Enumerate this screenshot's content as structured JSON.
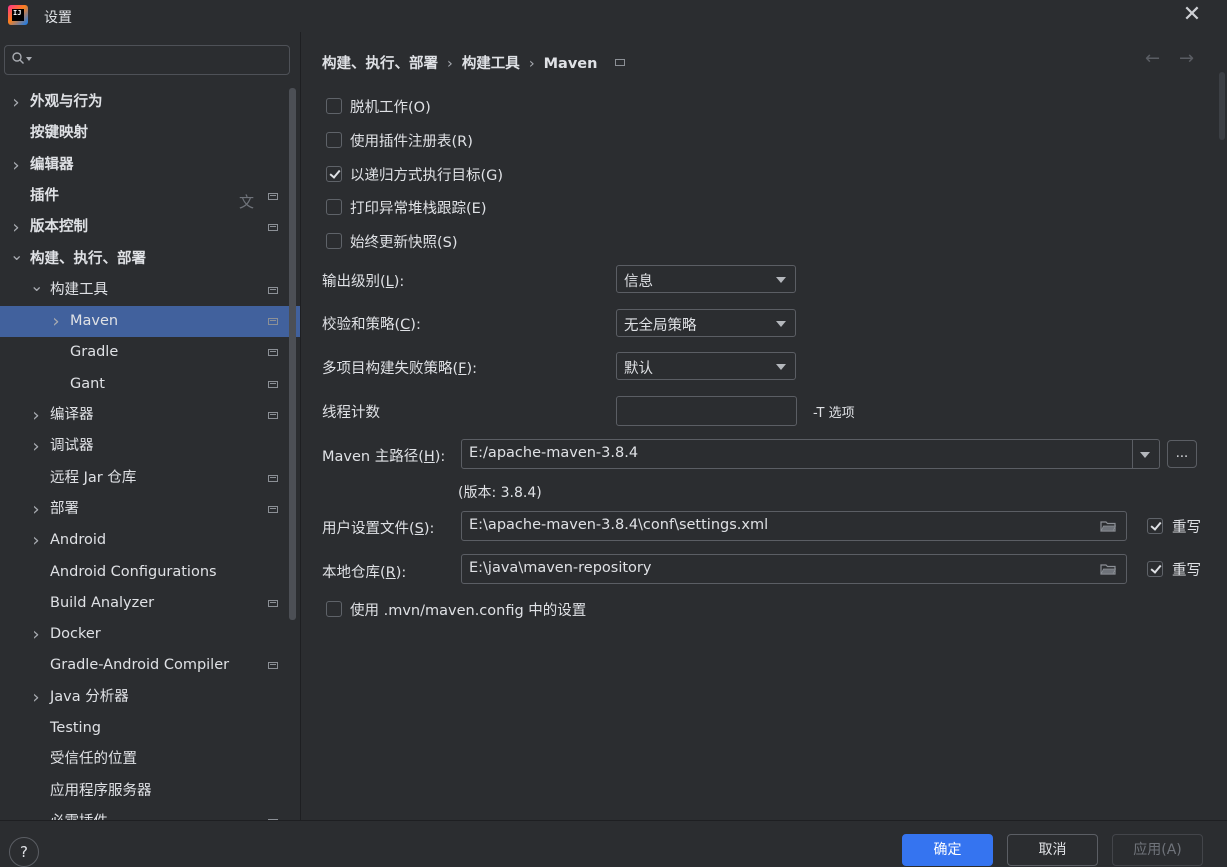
{
  "window": {
    "title": "设置"
  },
  "search": {
    "placeholder": ""
  },
  "sidebar": {
    "items": [
      {
        "label": "外观与行为",
        "bold": true,
        "chevron": "right"
      },
      {
        "label": "按键映射",
        "bold": true,
        "chevron": "none"
      },
      {
        "label": "编辑器",
        "bold": true,
        "chevron": "right"
      },
      {
        "label": "插件",
        "bold": true,
        "chevron": "none"
      },
      {
        "label": "版本控制",
        "bold": true,
        "chevron": "right"
      },
      {
        "label": "构建、执行、部署",
        "bold": true,
        "chevron": "down"
      },
      {
        "label": "构建工具",
        "bold": false,
        "chevron": "down"
      },
      {
        "label": "Maven",
        "bold": false,
        "chevron": "right",
        "selected": true
      },
      {
        "label": "Gradle",
        "bold": false,
        "chevron": "none"
      },
      {
        "label": "Gant",
        "bold": false,
        "chevron": "none"
      },
      {
        "label": "编译器",
        "bold": false,
        "chevron": "right"
      },
      {
        "label": "调试器",
        "bold": false,
        "chevron": "right"
      },
      {
        "label": "远程 Jar 仓库",
        "bold": false,
        "chevron": "none"
      },
      {
        "label": "部署",
        "bold": false,
        "chevron": "right"
      },
      {
        "label": "Android",
        "bold": false,
        "chevron": "right"
      },
      {
        "label": "Android Configurations",
        "bold": false,
        "chevron": "none"
      },
      {
        "label": "Build Analyzer",
        "bold": false,
        "chevron": "none"
      },
      {
        "label": "Docker",
        "bold": false,
        "chevron": "right"
      },
      {
        "label": "Gradle-Android Compiler",
        "bold": false,
        "chevron": "none"
      },
      {
        "label": "Java 分析器",
        "bold": false,
        "chevron": "right"
      },
      {
        "label": "Testing",
        "bold": false,
        "chevron": "none"
      },
      {
        "label": "受信任的位置",
        "bold": false,
        "chevron": "none"
      },
      {
        "label": "应用程序服务器",
        "bold": false,
        "chevron": "none"
      },
      {
        "label": "必需插件",
        "bold": false,
        "chevron": "none"
      }
    ]
  },
  "breadcrumb": {
    "items": [
      "构建、执行、部署",
      "构建工具",
      "Maven"
    ],
    "separator": "›"
  },
  "options": {
    "offline": {
      "label": "脱机工作(O)",
      "checked": false
    },
    "plugin_registry": {
      "label": "使用插件注册表(R)",
      "checked": false
    },
    "recursive": {
      "label": "以递归方式执行目标(G)",
      "checked": true
    },
    "print_stack": {
      "label": "打印异常堆栈跟踪(E)",
      "checked": false
    },
    "always_update": {
      "label": "始终更新快照(S)",
      "checked": false
    },
    "use_mvn_config": {
      "label": "使用 .mvn/maven.config 中的设置",
      "checked": false
    }
  },
  "fields": {
    "output_level": {
      "label_pre": "输出级别(",
      "mnemonic": "L",
      "label_post": "):",
      "value": "信息"
    },
    "checksum_policy": {
      "label_pre": "校验和策略(",
      "mnemonic": "C",
      "label_post": "):",
      "value": "无全局策略"
    },
    "failure_policy": {
      "label_pre": "多项目构建失败策略(",
      "mnemonic": "F",
      "label_post": "):",
      "value": "默认"
    },
    "thread_count": {
      "label": "线程计数",
      "value": "",
      "hint": "-T 选项"
    },
    "maven_home": {
      "label_pre": "Maven 主路径(",
      "mnemonic": "H",
      "label_post": "):",
      "value": "E:/apache-maven-3.8.4",
      "version": "(版本: 3.8.4)",
      "browse": "..."
    },
    "user_settings": {
      "label_pre": "用户设置文件(",
      "mnemonic": "S",
      "label_post": "):",
      "value": "E:\\apache-maven-3.8.4\\conf\\settings.xml",
      "override_label": "重写",
      "override_checked": true
    },
    "local_repo": {
      "label_pre": "本地仓库(",
      "mnemonic": "R",
      "label_post": "):",
      "value": "E:\\java\\maven-repository",
      "override_label": "重写",
      "override_checked": true
    }
  },
  "footer": {
    "help": "?",
    "ok": "确定",
    "cancel": "取消",
    "apply": "应用(A)"
  },
  "colors": {
    "background": "#2b2d30",
    "selection": "#2e436e",
    "primary_button": "#3574f0"
  }
}
